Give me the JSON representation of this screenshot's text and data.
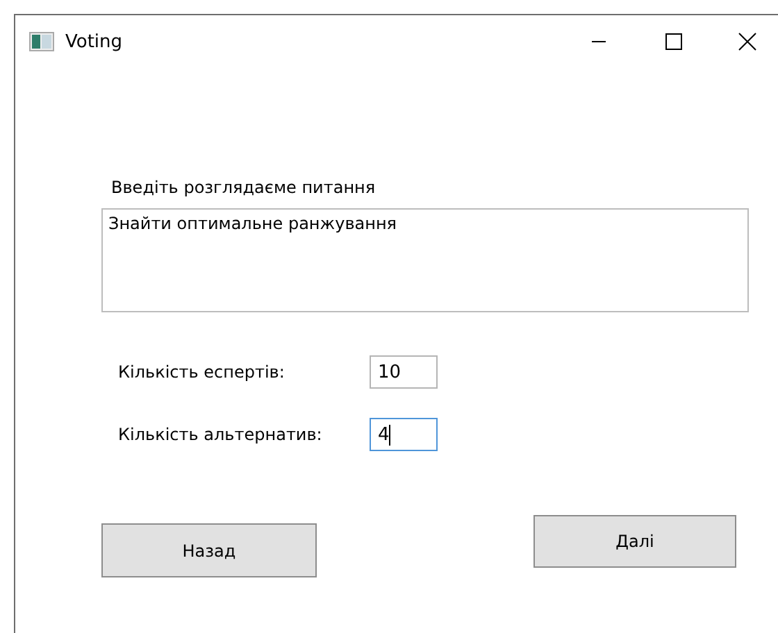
{
  "window": {
    "title": "Voting"
  },
  "question": {
    "label": "Введіть розглядаєме питання",
    "value": "Знайти оптимальне ранжування"
  },
  "fields": [
    {
      "label": "Кількість еспертів:",
      "value": "10",
      "focused": false
    },
    {
      "label": "Кількість альтернатив:",
      "value": "4",
      "focused": true
    }
  ],
  "buttons": [
    {
      "label": "Назад"
    },
    {
      "label": "Далі"
    }
  ]
}
